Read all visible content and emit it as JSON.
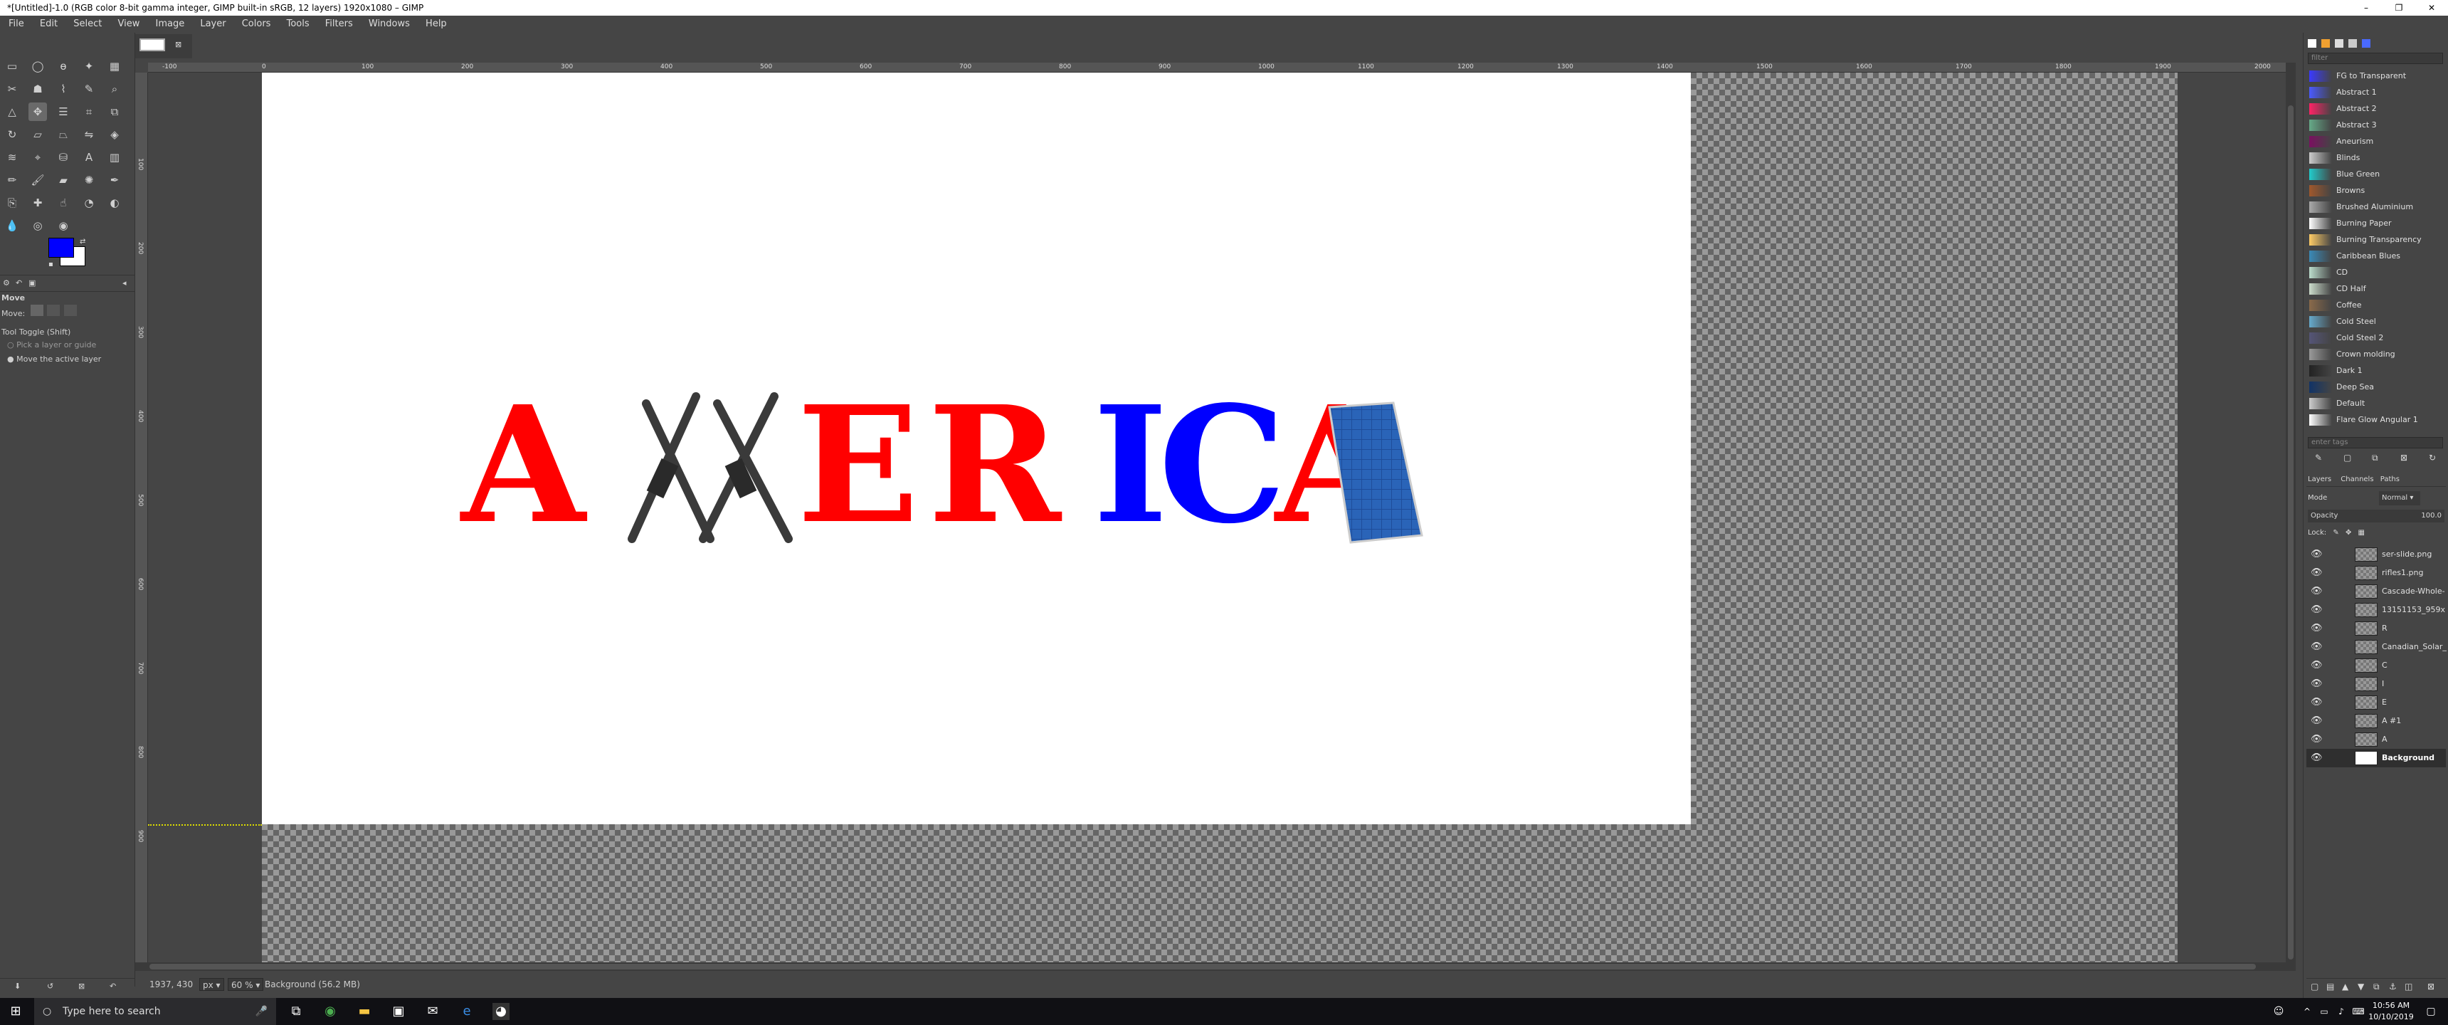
{
  "window": {
    "title": "*[Untitled]-1.0 (RGB color 8-bit gamma integer, GIMP built-in sRGB, 12 layers) 1920x1080 – GIMP",
    "minimize": "–",
    "maximize": "❐",
    "close": "✕"
  },
  "menu": [
    "File",
    "Edit",
    "Select",
    "View",
    "Image",
    "Layer",
    "Colors",
    "Tools",
    "Filters",
    "Windows",
    "Help"
  ],
  "colors": {
    "fg": "#0000ff",
    "bg": "#ffffff",
    "red": "#ff0000",
    "blue": "#0000ff",
    "panel": "#454545"
  },
  "tool_options": {
    "title": "Move",
    "move_label": "Move:",
    "toggle": "Tool Toggle  (Shift)",
    "opt1": "Pick a layer or guide",
    "opt2": "Move the active layer"
  },
  "rulers": {
    "h": [
      "-100",
      "0",
      "100",
      "200",
      "300",
      "400",
      "500",
      "600",
      "700",
      "800",
      "900",
      "1000",
      "1100",
      "1200",
      "1300",
      "1400",
      "1500",
      "1600",
      "1700",
      "1800",
      "1900",
      "2000"
    ],
    "v": [
      "100",
      "200",
      "300",
      "400",
      "500",
      "600",
      "700",
      "800",
      "900"
    ]
  },
  "canvas": {
    "letters": [
      "A",
      "E",
      "R",
      "I",
      "C",
      "A"
    ]
  },
  "status": {
    "coords": "1937, 430",
    "unit": "px",
    "zoom": "60 %",
    "layer_info": "Background (56.2 MB)"
  },
  "gradients": {
    "filter_placeholder": "filter",
    "items": [
      "FG to Transparent",
      "Abstract 1",
      "Abstract 2",
      "Abstract 3",
      "Aneurism",
      "Blinds",
      "Blue Green",
      "Browns",
      "Brushed Aluminium",
      "Burning Paper",
      "Burning Transparency",
      "Caribbean Blues",
      "CD",
      "CD Half",
      "Coffee",
      "Cold Steel",
      "Cold Steel 2",
      "Crown molding",
      "Dark 1",
      "Deep Sea",
      "Default",
      "Flare Glow Angular 1"
    ],
    "swatches": [
      "#3a3aff",
      "#4a5aff",
      "#ff2266",
      "#66aa88",
      "#7a1060",
      "#cccccc",
      "#22cccc",
      "#a0582c",
      "#aaaaaa",
      "#ffffff",
      "#ffcc66",
      "#3a8ab8",
      "#bbddcc",
      "#ccddcc",
      "#8a6a4a",
      "#66aacc",
      "#555577",
      "#999999",
      "#222222",
      "#113366",
      "#cccccc",
      "#ffffff"
    ],
    "footer": "enter tags"
  },
  "layers": {
    "tabs": [
      "Layers",
      "Channels",
      "Paths"
    ],
    "mode_label": "Mode",
    "mode_value": "Normal",
    "opacity_label": "Opacity",
    "opacity_value": "100.0",
    "lock_label": "Lock:",
    "items": [
      "ser-slide.png",
      "rifles1.png",
      "Cascade-Whole-",
      "13151153_959x",
      "R",
      "Canadian_Solar_",
      "C",
      "I",
      "E",
      "A #1",
      "A",
      "Background"
    ]
  },
  "taskbar": {
    "search_placeholder": "Type here to search",
    "time": "10:56 AM",
    "date": "10/10/2019"
  }
}
